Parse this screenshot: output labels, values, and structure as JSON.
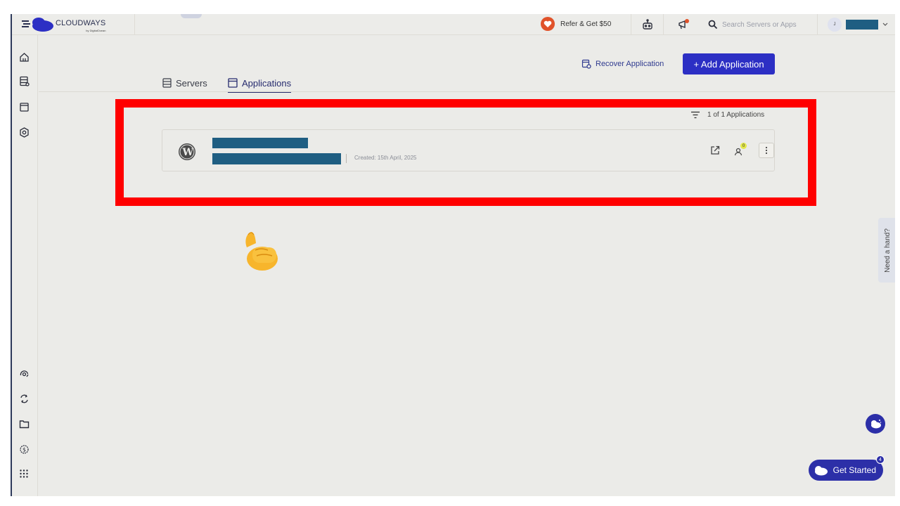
{
  "brand": {
    "name": "CLOUDWAYS",
    "sub": "by DigitalOcean"
  },
  "topbar": {
    "refer_label": "Refer & Get $50",
    "search_placeholder": "Search Servers or Apps",
    "user_initial": "J"
  },
  "tabs": [
    {
      "label": "Servers",
      "icon": "server-icon",
      "active": false
    },
    {
      "label": "Applications",
      "icon": "window-icon",
      "active": true
    }
  ],
  "actions": {
    "recover_label": "Recover Application",
    "add_label": "+ Add Application"
  },
  "applications": {
    "count_label": "1 of 1 Applications",
    "rows": [
      {
        "platform": "wordpress-icon",
        "created": "Created: 15th April, 2025",
        "collaborators": "0"
      }
    ]
  },
  "help_tab": "Need a hand?",
  "get_started": {
    "label": "Get Started",
    "badge": "4"
  },
  "colors": {
    "accent": "#2c2fc4",
    "highlight": "#ff0000",
    "redaction": "#1f5e82"
  }
}
